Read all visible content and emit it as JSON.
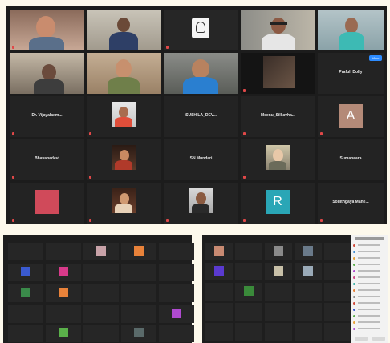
{
  "gallery": {
    "view_button": "View",
    "tiles": [
      {
        "name": "",
        "center": "",
        "kind": "video"
      },
      {
        "name": "",
        "center": "",
        "kind": "video"
      },
      {
        "name": "",
        "center": "",
        "kind": "logo"
      },
      {
        "name": "",
        "center": "",
        "kind": "video"
      },
      {
        "name": "",
        "center": "",
        "kind": "video"
      },
      {
        "name": "",
        "center": "",
        "kind": "video"
      },
      {
        "name": "",
        "center": "",
        "kind": "video"
      },
      {
        "name": "",
        "center": "",
        "kind": "video"
      },
      {
        "name": "",
        "center": "",
        "kind": "video"
      },
      {
        "name": "",
        "center": "Prafull Dolly",
        "kind": "text"
      },
      {
        "name": "",
        "center": "Dr. Vijayalaxm...",
        "kind": "text"
      },
      {
        "name": "",
        "center": "",
        "kind": "photo"
      },
      {
        "name": "",
        "center": "SUSHILA_DEV...",
        "kind": "text"
      },
      {
        "name": "",
        "center": "Meenu_Silkavha...",
        "kind": "text"
      },
      {
        "name": "",
        "center": "",
        "kind": "avatar",
        "letter": "A",
        "color": "#b48a78"
      },
      {
        "name": "",
        "center": "Bhavanadevi",
        "kind": "text"
      },
      {
        "name": "",
        "center": "",
        "kind": "photo"
      },
      {
        "name": "",
        "center": "SN Mundari",
        "kind": "text"
      },
      {
        "name": "",
        "center": "",
        "kind": "photo"
      },
      {
        "name": "",
        "center": "Sumanaara",
        "kind": "text"
      },
      {
        "name": "",
        "center": "",
        "kind": "avatar",
        "letter": "",
        "color": "#d04a5a"
      },
      {
        "name": "",
        "center": "",
        "kind": "photo"
      },
      {
        "name": "",
        "center": "",
        "kind": "photo"
      },
      {
        "name": "",
        "center": "",
        "kind": "avatar",
        "letter": "R",
        "color": "#2aa6b6"
      },
      {
        "name": "",
        "center": "Soulthgaya Mane...",
        "kind": "text"
      }
    ]
  },
  "colors": {
    "brand": "#2d8cff",
    "active_speaker": "#d6e042",
    "tile_bg": "#232323",
    "gallery_bg": "#1c1c1c"
  }
}
